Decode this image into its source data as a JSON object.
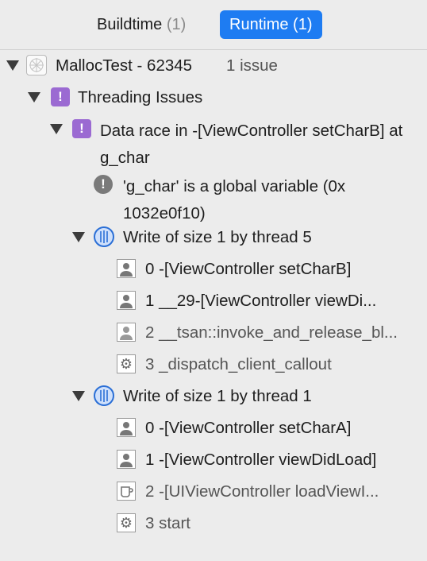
{
  "tabs": [
    {
      "label": "Buildtime",
      "count": "(1)",
      "active": false
    },
    {
      "label": "Runtime",
      "count": "(1)",
      "active": true
    }
  ],
  "tree": {
    "project": {
      "name": "MallocTest - 62345",
      "meta": "1 issue"
    },
    "category": "Threading Issues",
    "issue": "Data race in -[ViewController setCharB] at g_char",
    "note": "'g_char' is a global variable (0x 1032e0f10)",
    "threads": [
      {
        "label": "Write of size 1 by thread 5",
        "frames": [
          {
            "text": "0 -[ViewController setCharB]",
            "icon": "user-frame-icon",
            "dim": false
          },
          {
            "text": "1 __29-[ViewController viewDi...",
            "icon": "user-frame-icon",
            "dim": false
          },
          {
            "text": "2 __tsan::invoke_and_release_bl...",
            "icon": "user-frame-icon",
            "dim": true
          },
          {
            "text": "3 _dispatch_client_callout",
            "icon": "gear-icon",
            "dim": true
          }
        ]
      },
      {
        "label": "Write of size 1 by thread 1",
        "frames": [
          {
            "text": "0 -[ViewController setCharA]",
            "icon": "user-frame-icon",
            "dim": false
          },
          {
            "text": "1 -[ViewController viewDidLoad]",
            "icon": "user-frame-icon",
            "dim": false
          },
          {
            "text": "2 -[UIViewController loadViewI...",
            "icon": "coffee-cup-icon",
            "dim": true
          },
          {
            "text": "3 start",
            "icon": "gear-icon",
            "dim": true
          }
        ]
      }
    ]
  }
}
